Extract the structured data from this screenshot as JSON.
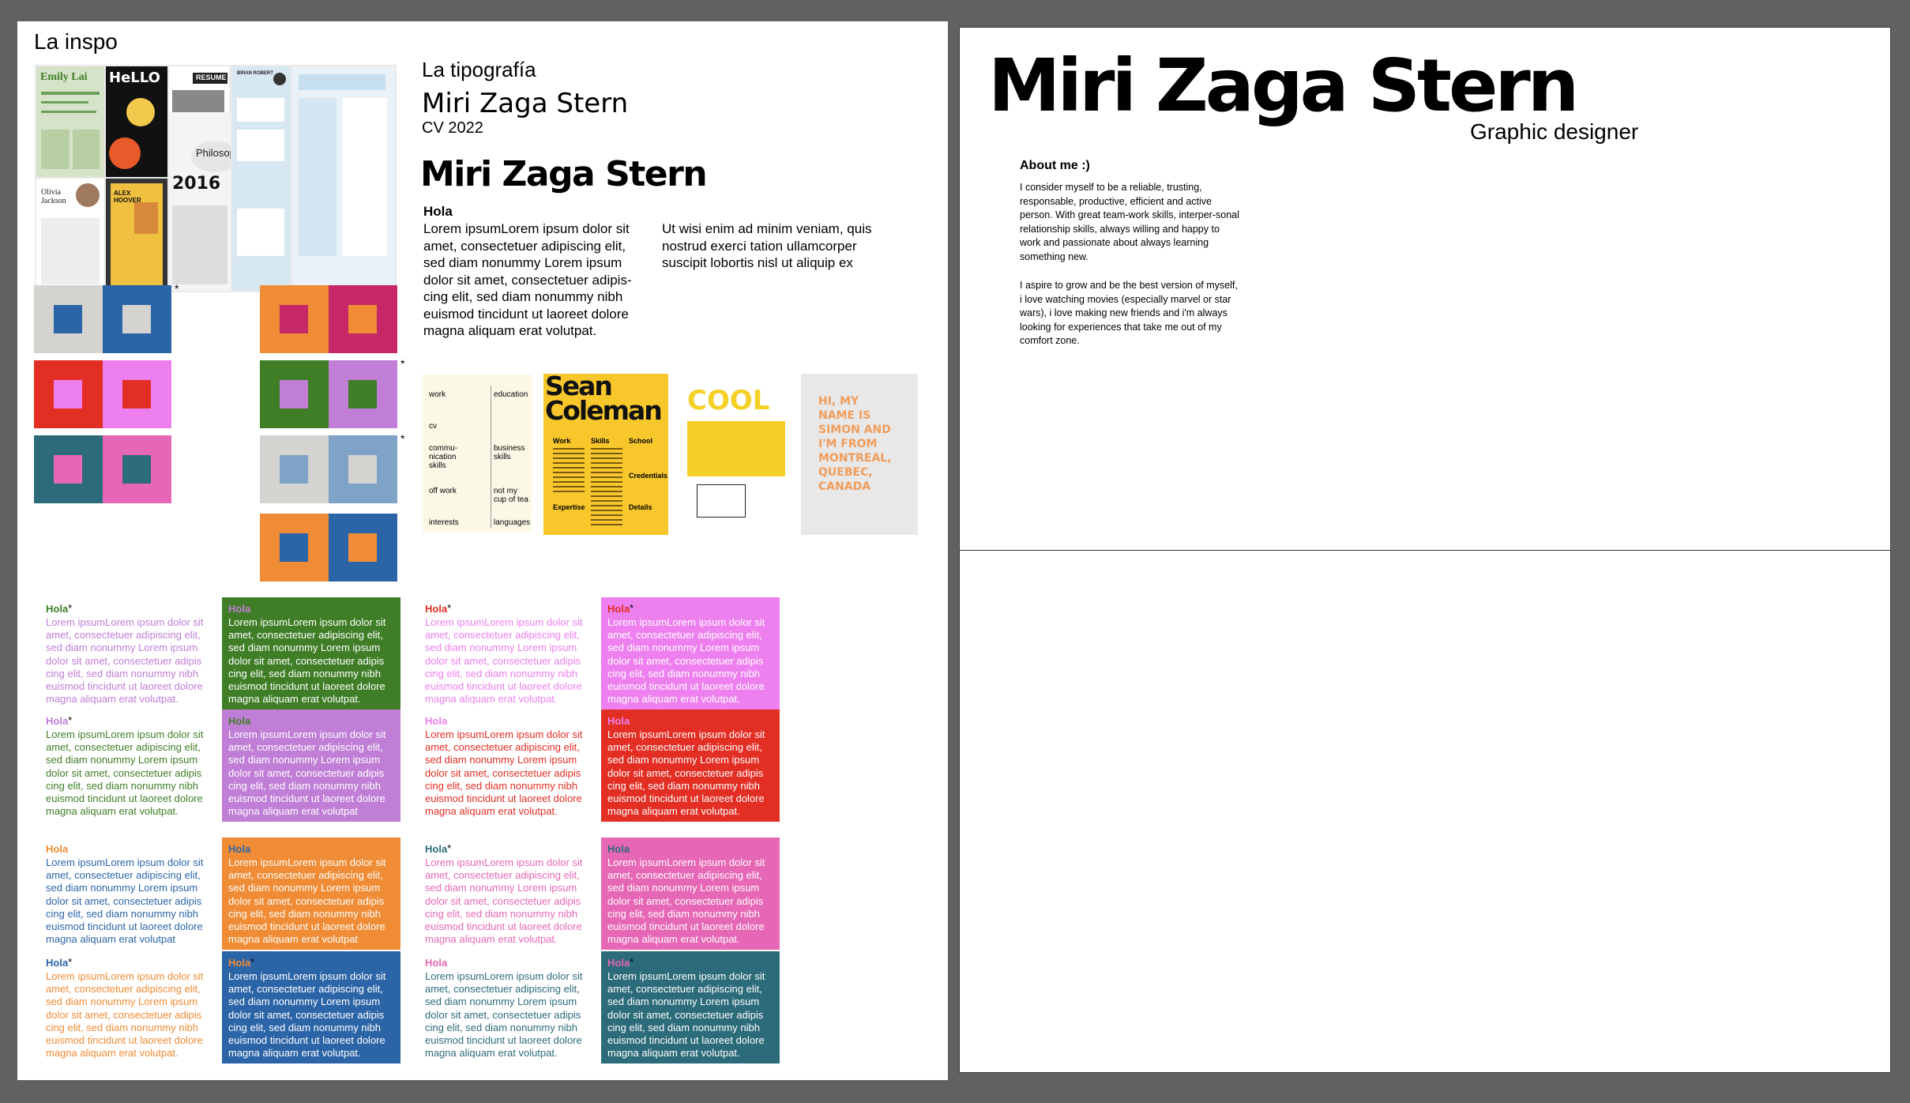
{
  "left_board": {
    "title": "La inspo",
    "typography_heading": "La tipografía",
    "name_outline": "Miri Zaga Stern",
    "cv_year": "CV 2022",
    "name_heavy": "Miri Zaga Stern",
    "sample_heading": "Hola",
    "sample_col1": "Lorem ipsumLorem ipsum dolor sit amet, consectetuer adipiscing elit, sed diam nonummy Lorem ipsum dolor sit amet, consectetuer adipis-cing elit, sed diam nonummy nibh euismod tincidunt ut laoreet dolore magna aliquam erat volutpat.",
    "sample_col2": "Ut wisi enim ad minim veniam, quis nostrud exerci tation ullamcorper suscipit lobortis nisl ut aliquip ex",
    "moodboard": {
      "emily": "Emily Lai",
      "hello": "HeLLO",
      "resume": "RESUME",
      "brian": "BRIAN ROBERT",
      "philosophy": "Philosophy",
      "year": "2016",
      "olivia": "Olivia Jackson",
      "alex": "ALEX HOOVER"
    },
    "resume_samples": {
      "grid_cells": [
        "work",
        "education",
        "cv",
        "",
        "commu-nication skills",
        "business skills",
        "off work",
        "not my cup of tea",
        "interests",
        "languages"
      ],
      "sean": "Sean Coleman",
      "sean_cols": [
        "Work",
        "Skills",
        "School",
        "Credentials",
        "Expertise",
        "Details"
      ],
      "cool": "COOL",
      "hi_text": "HI, MY NAME IS SIMON AND I'M FROM MONTREAL, QUEBEC, CANADA"
    },
    "color_pairs": [
      {
        "outer_left": "#d5d3d0",
        "inner_left": "#2c65a7",
        "outer_right": "#2c65a7",
        "inner_right": "#d5d3d0",
        "asterisk": "*"
      },
      {
        "outer_left": "#e32e24",
        "inner_left": "#ed80ee",
        "outer_right": "#ed80ee",
        "inner_right": "#e32e24",
        "asterisk": ""
      },
      {
        "outer_left": "#2c6b7a",
        "inner_left": "#e667b5",
        "outer_right": "#e667b5",
        "inner_right": "#2c6b7a",
        "asterisk": ""
      },
      {
        "outer_left": "#ef8c35",
        "inner_left": "#c52767",
        "outer_right": "#c52767",
        "inner_right": "#ef8c35",
        "asterisk": ""
      },
      {
        "outer_left": "#3f7e27",
        "inner_left": "#c07ed6",
        "outer_right": "#c07ed6",
        "inner_right": "#3f7e27",
        "asterisk": "*"
      },
      {
        "outer_left": "#d5d3d0",
        "inner_left": "#7fa2c7",
        "outer_right": "#7fa2c7",
        "inner_right": "#d5d3d0",
        "asterisk": "*"
      },
      {
        "outer_left": "#ef8c35",
        "inner_left": "#2c65a7",
        "outer_right": "#2c65a7",
        "inner_right": "#ef8c35",
        "asterisk": ""
      }
    ],
    "type_samples": [
      {
        "heading": "Hola",
        "body": "Lorem ipsumLorem ipsum dolor sit amet, consectetuer adipiscing elit, sed diam nonummy Lorem ipsum dolor sit amet, consectetuer adipis cing elit, sed diam nonummy nibh euismod tincidunt ut laoreet dolore magna aliquam erat volutpat.",
        "bg": "#ffffff",
        "heading_color": "#3f7e27",
        "text_color": "#c07ed6",
        "asterisk": "*"
      },
      {
        "heading": "Hola",
        "body": "Lorem ipsumLorem ipsum dolor sit amet, consectetuer adipiscing elit, sed diam nonummy Lorem ipsum dolor sit amet, consectetuer adipis cing elit, sed diam nonummy nibh euismod tincidunt ut laoreet dolore magna aliquam erat volutpat.",
        "bg": "#3f7e27",
        "heading_color": "#c07ed6",
        "text_color": "#ffffff",
        "asterisk": ""
      },
      {
        "heading": "Hola",
        "body": "Lorem ipsumLorem ipsum dolor sit amet, consectetuer adipiscing elit, sed diam nonummy Lorem ipsum dolor sit amet, consectetuer adipis cing elit, sed diam nonummy nibh euismod tincidunt ut laoreet dolore magna aliquam erat volutpat.",
        "bg": "#ffffff",
        "heading_color": "#e32e24",
        "text_color": "#ed80ee",
        "asterisk": "*"
      },
      {
        "heading": "Hola",
        "body": "Lorem ipsumLorem ipsum dolor sit amet, consectetuer adipiscing elit, sed diam nonummy Lorem ipsum dolor sit amet, consectetuer adipis cing elit, sed diam nonummy nibh euismod tincidunt ut laoreet dolore magna aliquam erat volutpat.",
        "bg": "#ed80ee",
        "heading_color": "#e32e24",
        "text_color": "#ffffff",
        "asterisk": "*"
      },
      {
        "heading": "Hola",
        "body": "Lorem ipsumLorem ipsum dolor sit amet, consectetuer adipiscing elit, sed diam nonummy Lorem ipsum dolor sit amet, consectetuer adipis cing elit, sed diam nonummy nibh euismod tincidunt ut laoreet dolore magna aliquam erat volutpat.",
        "bg": "#ffffff",
        "heading_color": "#c07ed6",
        "text_color": "#3f7e27",
        "asterisk": "*"
      },
      {
        "heading": "Hola",
        "body": "Lorem ipsumLorem ipsum dolor sit amet, consectetuer adipiscing elit, sed diam nonummy Lorem ipsum dolor sit amet, consectetuer adipis cing elit, sed diam nonummy nibh euismod tincidunt ut laoreet dolore magna aliquam erat volutpat",
        "bg": "#c07ed6",
        "heading_color": "#3f7e27",
        "text_color": "#ffffff",
        "asterisk": ""
      },
      {
        "heading": "Hola",
        "body": "Lorem ipsumLorem ipsum dolor sit amet, consectetuer adipiscing elit, sed diam nonummy Lorem ipsum dolor sit amet, consectetuer adipis cing elit, sed diam nonummy nibh euismod tincidunt ut laoreet dolore magna aliquam erat volutpat.",
        "bg": "#ffffff",
        "heading_color": "#ed80ee",
        "text_color": "#e32e24",
        "asterisk": ""
      },
      {
        "heading": "Hola",
        "body": "Lorem ipsumLorem ipsum dolor sit amet, consectetuer adipiscing elit, sed diam nonummy Lorem ipsum dolor sit amet, consectetuer adipis cing elit, sed diam nonummy nibh euismod tincidunt ut laoreet dolore magna aliquam erat volutpat.",
        "bg": "#e32e24",
        "heading_color": "#ed80ee",
        "text_color": "#ffffff",
        "asterisk": ""
      },
      {
        "heading": "Hola",
        "body": "Lorem ipsumLorem ipsum dolor sit amet, consectetuer adipiscing elit, sed diam nonummy Lorem ipsum dolor sit amet, consectetuer adipis cing elit, sed diam nonummy nibh euismod tincidunt ut laoreet dolore magna aliquam erat volutpat",
        "bg": "#ffffff",
        "heading_color": "#ef8c35",
        "text_color": "#2c65a7",
        "asterisk": ""
      },
      {
        "heading": "Hola",
        "body": "Lorem ipsumLorem ipsum dolor sit amet, consectetuer adipiscing elit, sed diam nonummy Lorem ipsum dolor sit amet, consectetuer adipis cing elit, sed diam nonummy nibh euismod tincidunt ut laoreet dolore magna aliquam erat volutpat",
        "bg": "#ef8c35",
        "heading_color": "#2c65a7",
        "text_color": "#ffffff",
        "asterisk": ""
      },
      {
        "heading": "Hola",
        "body": "Lorem ipsumLorem ipsum dolor sit amet, consectetuer adipiscing elit, sed diam nonummy Lorem ipsum dolor sit amet, consectetuer adipis cing elit, sed diam nonummy nibh euismod tincidunt ut laoreet dolore magna aliquam erat volutpat.",
        "bg": "#ffffff",
        "heading_color": "#2c6b7a",
        "text_color": "#e667b5",
        "asterisk": "*"
      },
      {
        "heading": "Hola",
        "body": "Lorem ipsumLorem ipsum dolor sit amet, consectetuer adipiscing elit, sed diam nonummy Lorem ipsum dolor sit amet, consectetuer adipis cing elit, sed diam nonummy nibh euismod tincidunt ut laoreet dolore magna aliquam erat volutpat.",
        "bg": "#e667b5",
        "heading_color": "#2c6b7a",
        "text_color": "#ffffff",
        "asterisk": ""
      },
      {
        "heading": "Hola",
        "body": "Lorem ipsumLorem ipsum dolor sit amet, consectetuer adipiscing elit, sed diam nonummy Lorem ipsum dolor sit amet, consectetuer adipis cing elit, sed diam nonummy nibh euismod tincidunt ut laoreet dolore magna aliquam erat volutpat.",
        "bg": "#ffffff",
        "heading_color": "#2c65a7",
        "text_color": "#ef8c35",
        "asterisk": "*"
      },
      {
        "heading": "Hola",
        "body": "Lorem ipsumLorem ipsum dolor sit amet, consectetuer adipiscing elit, sed diam nonummy Lorem ipsum dolor sit amet, consectetuer adipis cing elit, sed diam nonummy nibh euismod tincidunt ut laoreet dolore magna aliquam erat volutpat.",
        "bg": "#2c65a7",
        "heading_color": "#ef8c35",
        "text_color": "#ffffff",
        "asterisk": "*"
      },
      {
        "heading": "Hola",
        "body": "Lorem ipsumLorem ipsum dolor sit amet, consectetuer adipiscing elit, sed diam nonummy Lorem ipsum dolor sit amet, consectetuer adipis cing elit, sed diam nonummy nibh euismod tincidunt ut laoreet dolore magna aliquam erat volutpat.",
        "bg": "#ffffff",
        "heading_color": "#e667b5",
        "text_color": "#2c6b7a",
        "asterisk": ""
      },
      {
        "heading": "Hola",
        "body": "Lorem ipsumLorem ipsum dolor sit amet, consectetuer adipiscing elit, sed diam nonummy Lorem ipsum dolor sit amet, consectetuer adipis cing elit, sed diam nonummy nibh euismod tincidunt ut laoreet dolore magna aliquam erat volutpat.",
        "bg": "#2c6b7a",
        "heading_color": "#e667b5",
        "text_color": "#ffffff",
        "asterisk": "*"
      }
    ]
  },
  "cv_page": {
    "name": "Miri Zaga Stern",
    "role": "Graphic designer",
    "about_heading": "About me :)",
    "about_p1": "I consider myself to be a reliable, trusting, responsable, productive, efficient and active person. With great team-work skills, interper-sonal relationship skills, always willing and happy to work and passionate about always learning something new.",
    "about_p2": "I aspire to grow and be the best version of myself, i love watching movies (especially marvel or star wars), i love making new friends and i'm always looking for experiences that take me out of my comfort zone."
  }
}
